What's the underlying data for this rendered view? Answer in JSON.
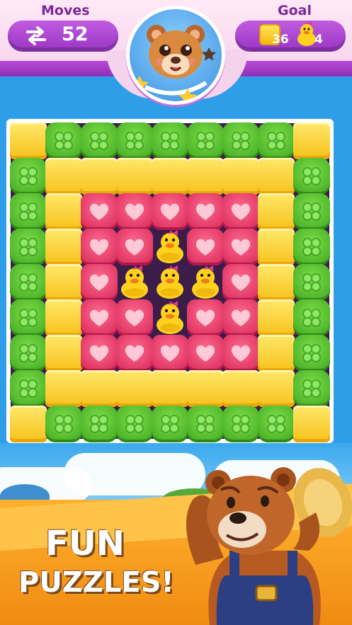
{
  "hud": {
    "moves_label": "Moves",
    "moves_value": "52",
    "goal_label": "Goal",
    "goals": [
      {
        "icon": "yellow-block-icon",
        "count": "36"
      },
      {
        "icon": "duck-icon",
        "count": "4"
      }
    ]
  },
  "board": {
    "rows": 9,
    "cols": 9,
    "grid": [
      [
        "Y",
        "G",
        "G",
        "G",
        "G",
        "G",
        "G",
        "G",
        "Y"
      ],
      [
        "G",
        "Y",
        "Y",
        "Y",
        "Y",
        "Y",
        "Y",
        "Y",
        "G"
      ],
      [
        "G",
        "Y",
        "P",
        "P",
        "P",
        "P",
        "P",
        "Y",
        "G"
      ],
      [
        "G",
        "Y",
        "P",
        "P",
        "D",
        "P",
        "P",
        "Y",
        "G"
      ],
      [
        "G",
        "Y",
        "P",
        "D",
        "D",
        "D",
        "P",
        "Y",
        "G"
      ],
      [
        "G",
        "Y",
        "P",
        "P",
        "D",
        "P",
        "P",
        "Y",
        "G"
      ],
      [
        "G",
        "Y",
        "P",
        "P",
        "P",
        "P",
        "P",
        "Y",
        "G"
      ],
      [
        "G",
        "Y",
        "Y",
        "Y",
        "Y",
        "Y",
        "Y",
        "Y",
        "G"
      ],
      [
        "Y",
        "G",
        "G",
        "G",
        "G",
        "G",
        "G",
        "G",
        "Y"
      ]
    ],
    "legend": {
      "Y": "yellow-block",
      "G": "green-clover",
      "P": "pink-heart",
      "D": "duck"
    }
  },
  "promo": {
    "line1": "FUN",
    "line2": "PUZZLES!"
  },
  "colors": {
    "hud_purple": "#9a36c4",
    "board_bg": "#3c1d4a",
    "sky": "#2f9ee8",
    "promo_orange": "#f08b12"
  }
}
